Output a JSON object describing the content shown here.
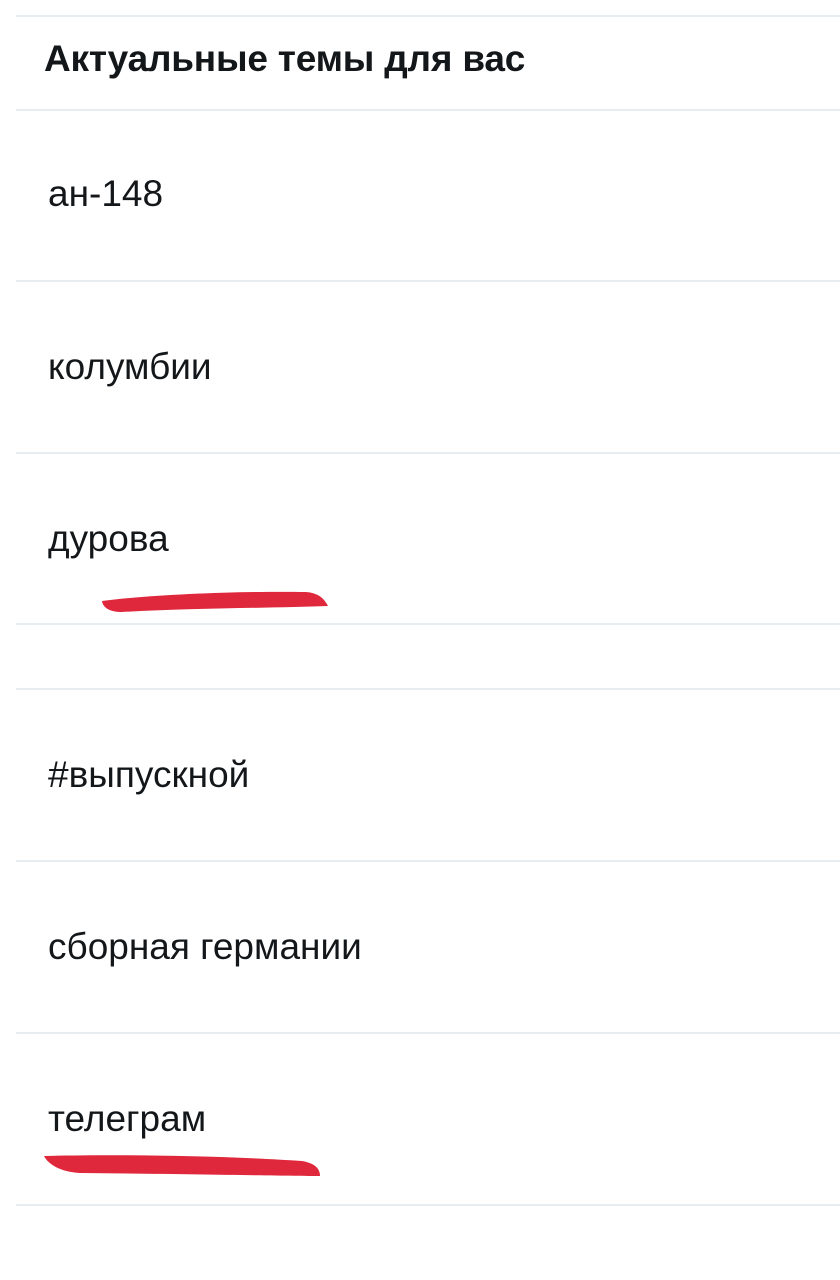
{
  "section": {
    "title": "Актуальные темы для вас"
  },
  "trends": [
    {
      "label": "ан-148"
    },
    {
      "label": "колумбии"
    },
    {
      "label": "дурова"
    },
    {
      "label": ""
    },
    {
      "label": "#выпускной"
    },
    {
      "label": "сборная германии"
    },
    {
      "label": "телеграм"
    }
  ],
  "colors": {
    "text": "#14171a",
    "divider": "#e6ecf0",
    "highlight_mark": "#e0283c"
  }
}
